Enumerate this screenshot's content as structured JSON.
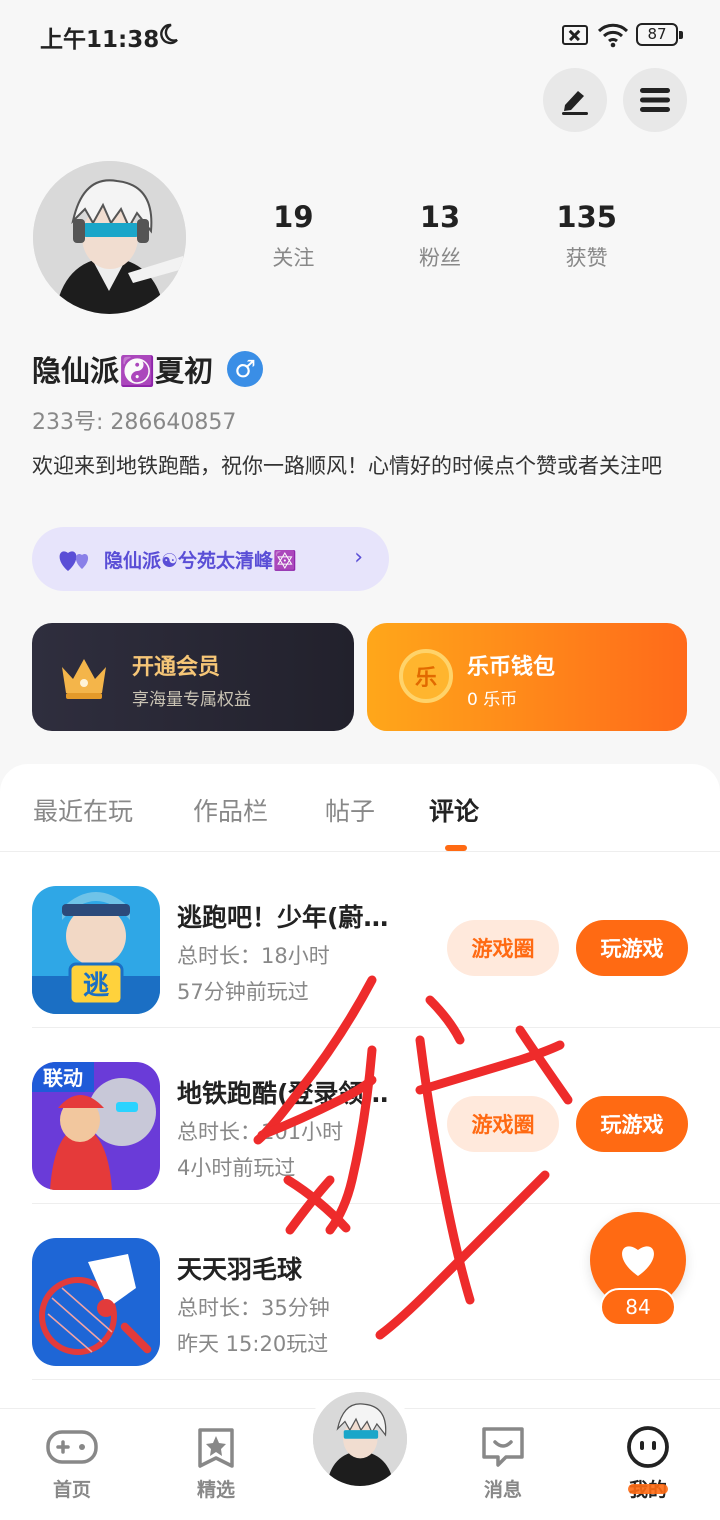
{
  "status_bar": {
    "time": "上午11:38",
    "battery": "87"
  },
  "profile": {
    "stats": [
      {
        "value": "19",
        "label": "关注"
      },
      {
        "value": "13",
        "label": "粉丝"
      },
      {
        "value": "135",
        "label": "获赞"
      }
    ],
    "username": "隐仙派☯️夏初",
    "gender_symbol": "♂",
    "id_text": "233号: 286640857",
    "bio": "欢迎来到地铁跑酷，祝你一路顺风！心情好的时候点个赞或者关注吧",
    "club_name": "隐仙派☯兮苑太清峰🔯",
    "club_arrow": "›"
  },
  "cards": {
    "vip": {
      "title": "开通会员",
      "subtitle": "享海量专属权益"
    },
    "wallet": {
      "title": "乐币钱包",
      "subtitle": "0 乐币",
      "coin_glyph": "乐"
    }
  },
  "tabs": [
    {
      "label": "最近在玩",
      "active": false
    },
    {
      "label": "作品栏",
      "active": false
    },
    {
      "label": "帖子",
      "active": false
    },
    {
      "label": "评论",
      "active": true
    }
  ],
  "games": [
    {
      "name": "逃跑吧！少年(蔚…",
      "duration": "总时长：18小时",
      "last_played": "57分钟前玩过",
      "circle_label": "游戏圈",
      "play_label": "玩游戏",
      "has_circle": true,
      "icon_glyph": "逃"
    },
    {
      "name": "地铁跑酷(登录领…",
      "duration": "总时长：101小时",
      "last_played": "4小时前玩过",
      "circle_label": "游戏圈",
      "play_label": "玩游戏",
      "has_circle": true,
      "icon_glyph": "联动"
    },
    {
      "name": "天天羽毛球",
      "duration": "总时长：35分钟",
      "last_played": "昨天 15:20玩过",
      "circle_label": "",
      "play_label": "",
      "has_circle": false
    }
  ],
  "like_float": {
    "count": "84"
  },
  "bottom_nav": [
    {
      "label": "首页",
      "icon": "gamepad-icon",
      "active": false
    },
    {
      "label": "精选",
      "icon": "star-tab-icon",
      "active": false
    },
    {
      "label": "",
      "icon": "avatar",
      "active": false
    },
    {
      "label": "消息",
      "icon": "message-icon",
      "active": false
    },
    {
      "label": "我的",
      "icon": "face-icon",
      "active": true
    }
  ],
  "colors": {
    "accent": "#ff6a13",
    "club_bg": "#e7e4fb",
    "club_text": "#5a4ed6",
    "vip_gold": "#f6c677",
    "scribble": "#ee2b2b"
  }
}
